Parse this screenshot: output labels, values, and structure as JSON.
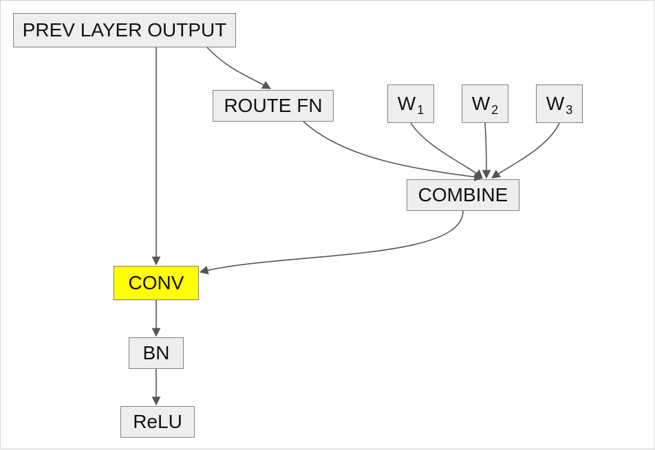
{
  "nodes": {
    "prev_layer_output": {
      "label": "PREV LAYER OUTPUT"
    },
    "route_fn": {
      "label": "ROUTE FN"
    },
    "w1": {
      "label": "W",
      "sub": "1"
    },
    "w2": {
      "label": "W",
      "sub": "2"
    },
    "w3": {
      "label": "W",
      "sub": "3"
    },
    "combine": {
      "label": "COMBINE"
    },
    "conv": {
      "label": "CONV"
    },
    "bn": {
      "label": "BN"
    },
    "relu": {
      "label": "ReLU"
    }
  },
  "edges": [
    {
      "from": "prev_layer_output",
      "to": "conv",
      "kind": "straight-down"
    },
    {
      "from": "prev_layer_output",
      "to": "route_fn",
      "kind": "curve"
    },
    {
      "from": "route_fn",
      "to": "combine",
      "kind": "curve"
    },
    {
      "from": "w1",
      "to": "combine",
      "kind": "curve"
    },
    {
      "from": "w2",
      "to": "combine",
      "kind": "curve"
    },
    {
      "from": "w3",
      "to": "combine",
      "kind": "curve"
    },
    {
      "from": "combine",
      "to": "conv",
      "kind": "curve"
    },
    {
      "from": "conv",
      "to": "bn",
      "kind": "straight-down"
    },
    {
      "from": "bn",
      "to": "relu",
      "kind": "straight-down"
    }
  ]
}
